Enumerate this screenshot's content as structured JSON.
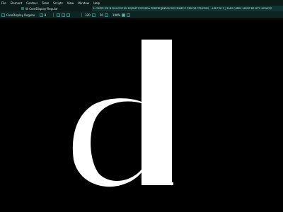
{
  "menubar": {
    "items": [
      "File",
      "Element",
      "Contour",
      "Tools",
      "Scripts",
      "View",
      "Window",
      "Help"
    ]
  },
  "tab": {
    "label": "W CoreDisplay-Regular"
  },
  "glyph_strip": {
    "text_1": "L CHFYL PN H DOOCDP SN EQRMT FCFSSDA FEDFRUJKKNSCNUCDMPCC TBX DR CTHCDIN",
    "text_2": "A B F DI U J LMN Q BBC MNOP RS NTU AVWXYZ"
  },
  "toolbar": {
    "font_name": "CoreDisplay Regular",
    "size_1": "8",
    "size_2": "320",
    "size_3": "50",
    "zoom": "100%"
  },
  "canvas": {
    "glyph": "d",
    "glyph_color": "#ffffff",
    "background": "#000000"
  }
}
